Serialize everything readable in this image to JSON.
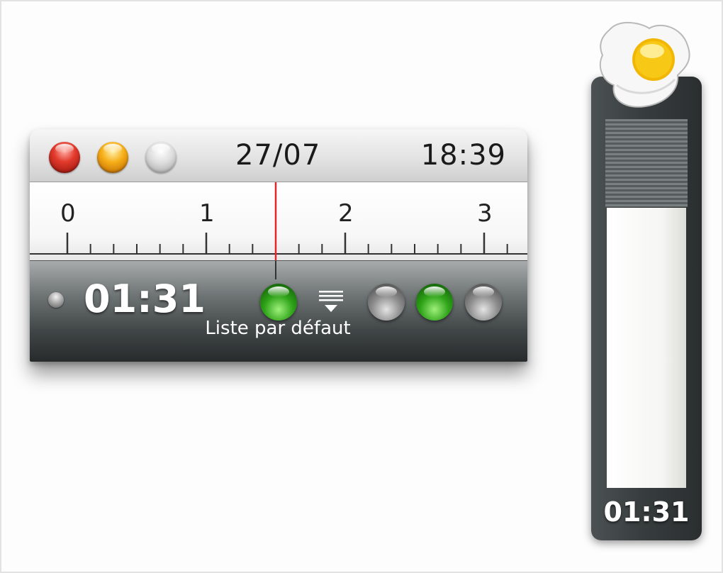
{
  "timer_window": {
    "title_bar": {
      "buttons": [
        {
          "name": "close",
          "icon": "red-close-button"
        },
        {
          "name": "minimize",
          "icon": "yellow-minimize-button"
        },
        {
          "name": "zoom",
          "icon": "grey-zoom-button"
        }
      ],
      "date": "27/07",
      "time": "18:39"
    },
    "ruler": {
      "labels": [
        "0",
        "1",
        "2",
        "3"
      ],
      "minor_ticks_per_unit": 6,
      "playhead_position": 1.5,
      "playhead_color": "#e2262b"
    },
    "controls": {
      "status_led": "grey-status-led",
      "elapsed": "01:31",
      "list_name": "Liste par défaut",
      "active_orb": {
        "icon": "green-orb",
        "state": "on"
      },
      "menu_icon": "list-dropdown-icon",
      "orbs": [
        {
          "icon": "grey-orb",
          "state": "off"
        },
        {
          "icon": "green-orb",
          "state": "on"
        },
        {
          "icon": "grey-orb",
          "state": "off"
        }
      ]
    }
  },
  "egg_widget": {
    "icon": "fried-egg-icon",
    "time": "01:31",
    "remaining_fraction": 0.76
  },
  "colors": {
    "accent_green": "#2ea318",
    "strip_dark": "#2a2e2f",
    "egg_yolk": "#f5c518"
  }
}
